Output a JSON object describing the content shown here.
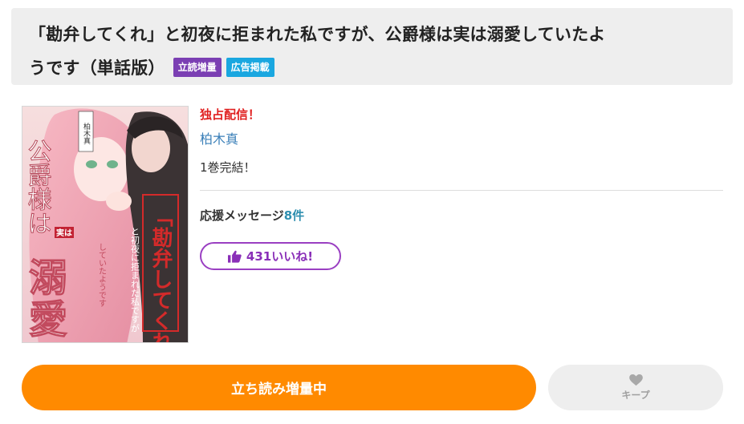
{
  "title": {
    "line1": "「勘弁してくれ」と初夜に拒まれた私ですが、公爵様は実は溺愛していたよ",
    "line2": "うです（単話版）",
    "badges": [
      {
        "label": "立読増量",
        "color": "#7b3fb3"
      },
      {
        "label": "広告掲載",
        "color": "#1aa7e0"
      }
    ]
  },
  "cover": {
    "vertical_title_left": "公爵様は",
    "jitsu": "実は",
    "big": "溺愛",
    "author_tag": "柏木真",
    "red_title": "「勘弁してくれ」",
    "subtitle": "と初夜に拒まれた私ですが",
    "subtitle2": "していたようです"
  },
  "info": {
    "exclusive": "独占配信！",
    "author": "柏木真",
    "volumes": "1巻完結！",
    "support_label": "応援メッセージ",
    "support_count": "8件",
    "like_label": "431いいね!"
  },
  "actions": {
    "read_label": "立ち読み増量中",
    "keep_label": "キープ"
  },
  "colors": {
    "accent_orange": "#ff8a00",
    "like_purple": "#9a3fc2",
    "exclusive_red": "#e02020",
    "author_blue": "#3a7fb8"
  }
}
